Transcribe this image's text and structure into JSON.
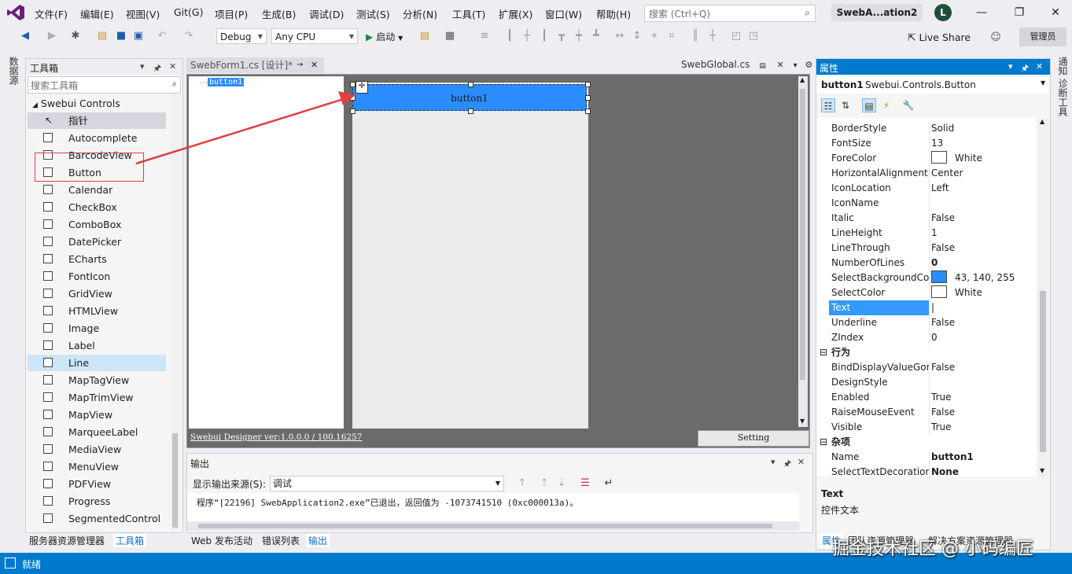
{
  "menu": {
    "items": [
      "文件(F)",
      "编辑(E)",
      "视图(V)",
      "Git(G)",
      "项目(P)",
      "生成(B)",
      "调试(D)",
      "测试(S)",
      "分析(N)",
      "工具(T)",
      "扩展(X)",
      "窗口(W)",
      "帮助(H)"
    ],
    "search_placeholder": "搜索 (Ctrl+Q)",
    "project_title": "SwebA...ation2",
    "avatar_letter": "L"
  },
  "toolbar": {
    "config": "Debug",
    "platform": "Any CPU",
    "start_label": "启动",
    "live_share": "Live Share",
    "admin": "管理员"
  },
  "left_vtab": "数据源",
  "toolbox": {
    "title": "工具箱",
    "search_placeholder": "搜索工具箱",
    "group": "Swebui Controls",
    "pointer": "指针",
    "items": [
      "Autocomplete",
      "BarcodeView",
      "Button",
      "Calendar",
      "CheckBox",
      "ComboBox",
      "DatePicker",
      "ECharts",
      "FontIcon",
      "GridView",
      "HTMLView",
      "Image",
      "Label",
      "Line",
      "MapTagView",
      "MapTrimView",
      "MapView",
      "MarqueeLabel",
      "MediaView",
      "MenuView",
      "PDFView",
      "Progress",
      "SegmentedControl"
    ],
    "bottom_tabs": [
      "服务器资源管理器",
      "工具箱"
    ]
  },
  "document": {
    "active_tab": "SwebForm1.cs [设计]*",
    "other_tab": "SwebGlobal.cs",
    "tree_node": "button1",
    "button_text": "button1",
    "version": "Swebui Designer ver:1.0.0.0 / 100.16257",
    "setting": "Setting"
  },
  "output": {
    "title": "输出",
    "source_label": "显示输出来源(S):",
    "source_value": "调试",
    "line": "程序“[22196] SwebApplication2.exe”已退出，返回值为 -1073741510 (0xc000013a)。",
    "bottom_tabs": [
      "Web 发布活动",
      "错误列表",
      "输出"
    ]
  },
  "properties": {
    "title": "属性",
    "object_name": "button1",
    "object_type": "Swebui.Controls.Button",
    "rows_appearance": [
      {
        "name": "BorderStyle",
        "value": "Solid"
      },
      {
        "name": "FontSize",
        "value": "13"
      },
      {
        "name": "ForeColor",
        "value": "White",
        "swatch": "#ffffff"
      },
      {
        "name": "HorizontalAlignment",
        "value": "Center"
      },
      {
        "name": "IconLocation",
        "value": "Left"
      },
      {
        "name": "IconName",
        "value": ""
      },
      {
        "name": "Italic",
        "value": "False"
      },
      {
        "name": "LineHeight",
        "value": "1"
      },
      {
        "name": "LineThrough",
        "value": "False"
      },
      {
        "name": "NumberOfLines",
        "value": "0"
      },
      {
        "name": "SelectBackgroundCol",
        "value": "43, 140, 255",
        "swatch": "#2b8cff"
      },
      {
        "name": "SelectColor",
        "value": "White",
        "swatch": "#ffffff"
      },
      {
        "name": "Text",
        "value": ""
      },
      {
        "name": "Underline",
        "value": "False"
      },
      {
        "name": "ZIndex",
        "value": "0"
      }
    ],
    "cat_behavior": "行为",
    "rows_behavior": [
      {
        "name": "BindDisplayValueGon",
        "value": "False"
      },
      {
        "name": "DesignStyle",
        "value": ""
      },
      {
        "name": "Enabled",
        "value": "True"
      },
      {
        "name": "RaiseMouseEvent",
        "value": "False"
      },
      {
        "name": "Visible",
        "value": "True"
      }
    ],
    "cat_misc": "杂项",
    "rows_misc": [
      {
        "name": "Name",
        "value": "button1"
      },
      {
        "name": "SelectTextDecoration",
        "value": "None"
      }
    ],
    "desc_title": "Text",
    "desc_text": "控件文本",
    "bottom_tabs": [
      "属性",
      "团队资源管理器",
      "解决方案资源管理器"
    ]
  },
  "right_vtab": "通知  诊断工具",
  "status": {
    "text": "就绪"
  },
  "watermark": "掘金技术社区 @ 小码编匠",
  "colors": {
    "accent": "#007acc",
    "button_blue": "#2b8cff",
    "annotation": "#e04040"
  }
}
